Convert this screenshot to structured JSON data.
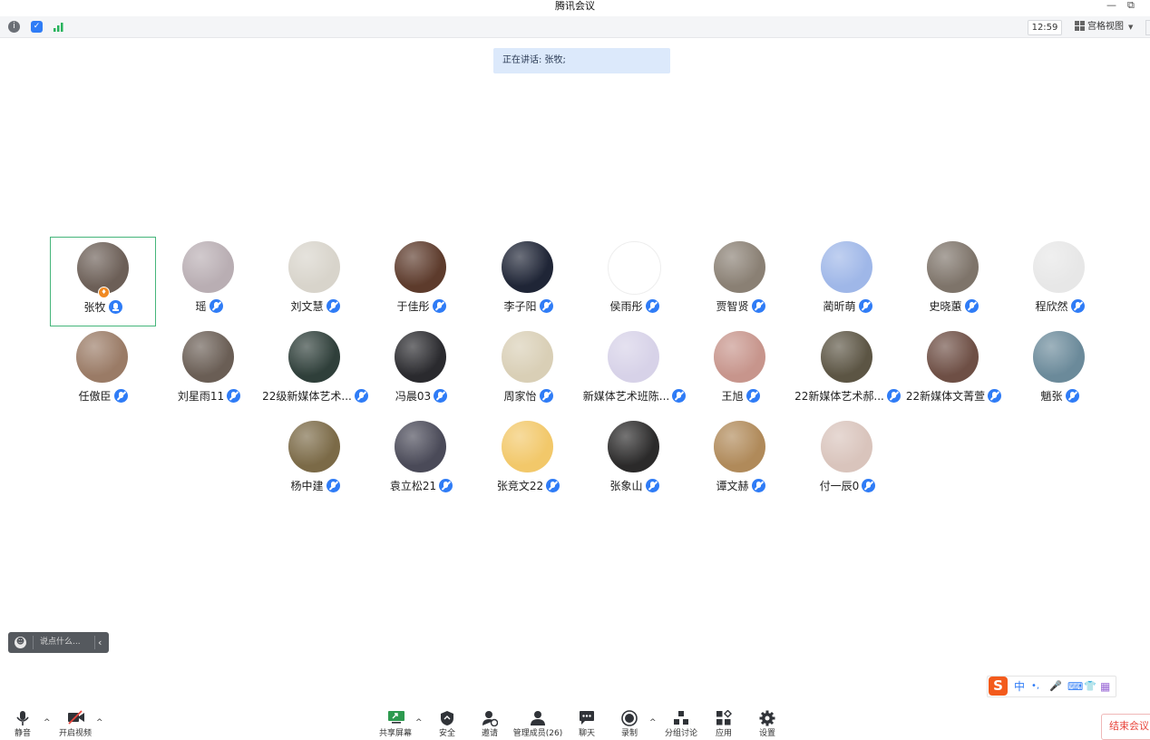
{
  "window": {
    "title": "腾讯会议",
    "minimize": "—",
    "restore": "⧉"
  },
  "infobar": {
    "clock": "12:59",
    "view_label": "宫格视图"
  },
  "speaking": "正在讲话: 张牧;",
  "participants": [
    {
      "name": "张牧",
      "color": "#6c5f57"
    },
    {
      "name": "瑶",
      "color": "#b9aeb3"
    },
    {
      "name": "刘文慧",
      "color": "#d8d4cb"
    },
    {
      "name": "于佳彤",
      "color": "#5d3b2c"
    },
    {
      "name": "李子阳",
      "color": "#1f2536"
    },
    {
      "name": "侯雨彤",
      "color": "#ffffff"
    },
    {
      "name": "贾智贤",
      "color": "#8a8074"
    },
    {
      "name": "蔺昕萌",
      "color": "#9fb7e8"
    },
    {
      "name": "史晓蕙",
      "color": "#7e746a"
    },
    {
      "name": "程欣然",
      "color": "#e7e7e7"
    },
    {
      "name": "任傲臣",
      "color": "#9a7b66"
    },
    {
      "name": "刘星雨11",
      "color": "#6a5e55"
    },
    {
      "name": "22级新媒体艺术...",
      "color": "#2f3f3a"
    },
    {
      "name": "冯晨03",
      "color": "#2a2a2e"
    },
    {
      "name": "周家怡",
      "color": "#d9cfb6"
    },
    {
      "name": "新媒体艺术班陈...",
      "color": "#d7d2e8"
    },
    {
      "name": "王旭",
      "color": "#c7958c"
    },
    {
      "name": "22新媒体艺术郝...",
      "color": "#5c5544"
    },
    {
      "name": "22新媒体文菁萱",
      "color": "#6e4f45"
    },
    {
      "name": "魈张",
      "color": "#6b8a9a"
    },
    {
      "name": "杨中建",
      "color": "#7b6a47"
    },
    {
      "name": "袁立松21",
      "color": "#4a4a58"
    },
    {
      "name": "张竞文22",
      "color": "#f2c86a"
    },
    {
      "name": "张象山",
      "color": "#2b2a2a"
    },
    {
      "name": "谭文赫",
      "color": "#b08a5a"
    },
    {
      "name": "付一辰0",
      "color": "#d9c4bc"
    }
  ],
  "chat": {
    "emoji": "☻",
    "placeholder": "说点什么...",
    "collapse": "‹"
  },
  "ime": {
    "logo": "S",
    "lang": "中",
    "punct": "•,",
    "mic": "🎤",
    "kbd": "⌨",
    "skin": "👕",
    "apps": "▦"
  },
  "toolbar": {
    "mute": "静音",
    "video": "开启视频",
    "share": "共享屏幕",
    "security": "安全",
    "invite": "邀请",
    "members": "管理成员(26)",
    "chat": "聊天",
    "record": "录制",
    "breakout": "分组讨论",
    "apps": "应用",
    "settings": "设置",
    "end": "结束会议",
    "caret": "^"
  },
  "colors": {
    "active_border": "#45b57a",
    "mic_blue": "#2f7cf6",
    "end_red": "#e8463d",
    "banner": "#dce9fb"
  }
}
